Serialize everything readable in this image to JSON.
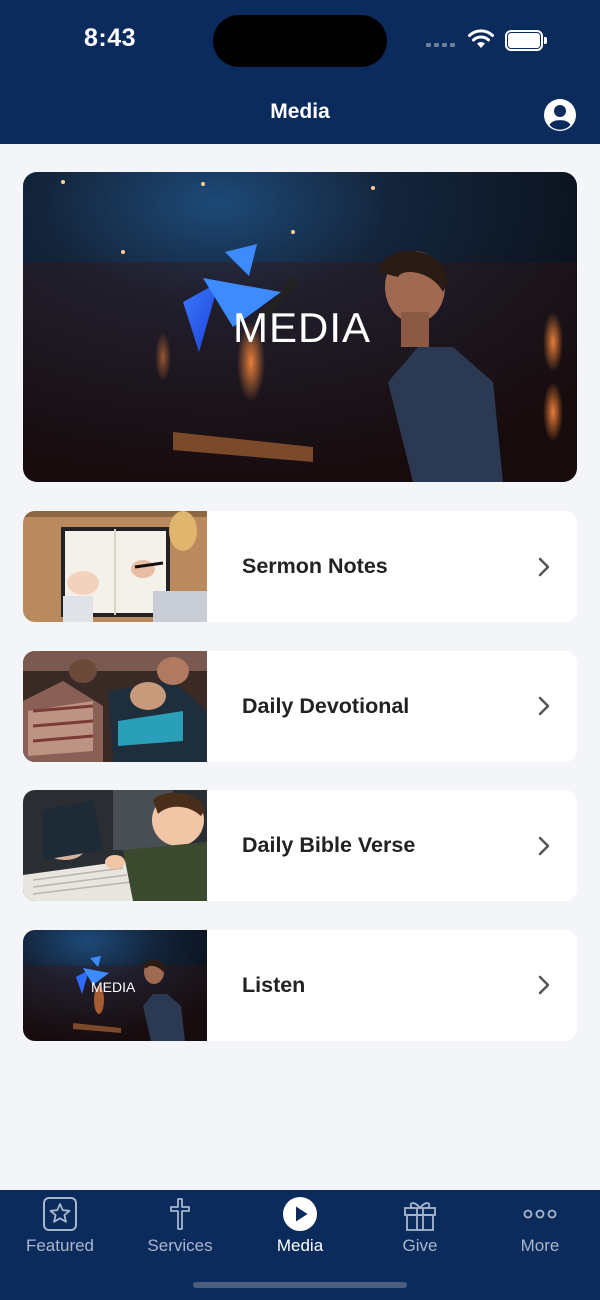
{
  "status_bar": {
    "time": "8:43"
  },
  "header": {
    "title": "Media"
  },
  "hero": {
    "logo_text": "MEDIA"
  },
  "items": [
    {
      "label": "Sermon Notes"
    },
    {
      "label": "Daily Devotional"
    },
    {
      "label": "Daily Bible Verse"
    },
    {
      "label": "Listen",
      "thumb_logo_text": "MEDIA"
    }
  ],
  "tabs": [
    {
      "label": "Featured",
      "icon": "star-icon",
      "active": false
    },
    {
      "label": "Services",
      "icon": "cross-icon",
      "active": false
    },
    {
      "label": "Media",
      "icon": "play-icon",
      "active": true
    },
    {
      "label": "Give",
      "icon": "gift-icon",
      "active": false
    },
    {
      "label": "More",
      "icon": "more-icon",
      "active": false
    }
  ],
  "colors": {
    "nav_bg": "#0b2b5c",
    "page_bg": "#f3f5f9",
    "accent_logo": "#2f6bff"
  }
}
